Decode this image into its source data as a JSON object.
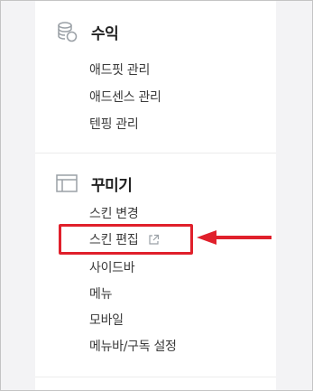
{
  "sections": {
    "revenue": {
      "title": "수익",
      "icon": "coin-stack-icon",
      "items": [
        {
          "label": "애드핏 관리"
        },
        {
          "label": "애드센스 관리"
        },
        {
          "label": "텐핑 관리"
        }
      ]
    },
    "decorate": {
      "title": "꾸미기",
      "icon": "layout-window-icon",
      "items": [
        {
          "label": "스킨 변경"
        },
        {
          "label": "스킨 편집",
          "icon": "external-link-icon",
          "highlighted": true
        },
        {
          "label": "사이드바"
        },
        {
          "label": "메뉴"
        },
        {
          "label": "모바일"
        },
        {
          "label": "메뉴바/구독 설정"
        }
      ]
    }
  },
  "colors": {
    "highlight": "#e0202b",
    "text": "#3a3a3a",
    "title": "#222222",
    "icon": "#9aa0a6"
  },
  "annotation": {
    "icon": "left-arrow-icon"
  }
}
